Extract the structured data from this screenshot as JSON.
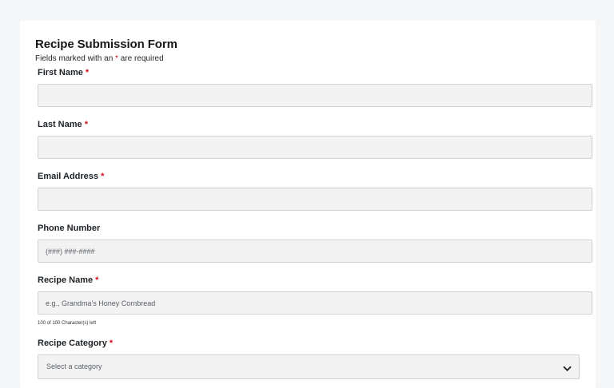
{
  "form": {
    "title": "Recipe Submission Form",
    "required_note_prefix": "Fields marked with an ",
    "required_note_star": "*",
    "required_note_suffix": " are required",
    "required_marker": "*"
  },
  "fields": {
    "first_name": {
      "label": "First Name",
      "required": true,
      "value": "",
      "placeholder": ""
    },
    "last_name": {
      "label": "Last Name",
      "required": true,
      "value": "",
      "placeholder": ""
    },
    "email": {
      "label": "Email Address",
      "required": true,
      "value": "",
      "placeholder": ""
    },
    "phone": {
      "label": "Phone Number",
      "required": false,
      "value": "",
      "placeholder": "(###) ###-####"
    },
    "recipe_name": {
      "label": "Recipe Name",
      "required": true,
      "value": "",
      "placeholder": "e.g., Grandma's Honey Cornbread",
      "char_count": "100 of 100 Character(s) left"
    },
    "recipe_category": {
      "label": "Recipe Category",
      "required": true,
      "selected": "Select a category"
    }
  },
  "icons": {
    "select_arrow": "chevron-down-icon"
  },
  "colors": {
    "required": "#d3111f",
    "page_background": "#f4f6f8",
    "input_background": "#f3f3f3",
    "input_border": "#cfd2d5"
  }
}
